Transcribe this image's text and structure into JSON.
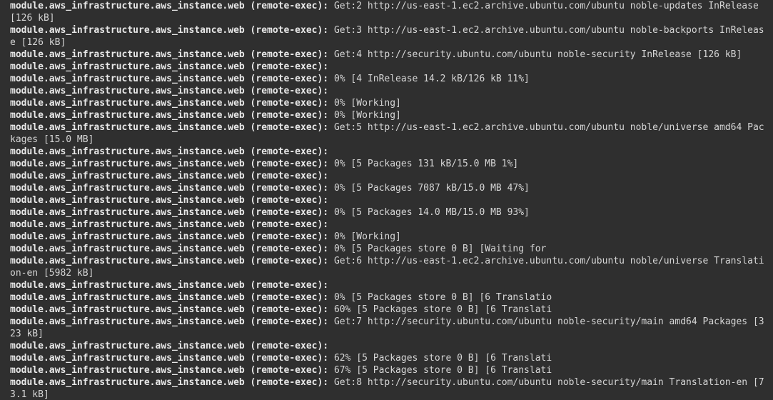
{
  "terminal": {
    "prefix": "module.aws_infrastructure.aws_instance.web (remote-exec):",
    "lines": [
      "Get:2 http://us-east-1.ec2.archive.ubuntu.com/ubuntu noble-updates InRelease [126 kB]",
      "Get:3 http://us-east-1.ec2.archive.ubuntu.com/ubuntu noble-backports InRelease [126 kB]",
      "Get:4 http://security.ubuntu.com/ubuntu noble-security InRelease [126 kB]",
      "",
      "0% [4 InRelease 14.2 kB/126 kB 11%]",
      "",
      "0% [Working]",
      "0% [Working]",
      "Get:5 http://us-east-1.ec2.archive.ubuntu.com/ubuntu noble/universe amd64 Packages [15.0 MB]",
      "",
      "0% [5 Packages 131 kB/15.0 MB 1%]",
      "",
      "0% [5 Packages 7087 kB/15.0 MB 47%]",
      "",
      "0% [5 Packages 14.0 MB/15.0 MB 93%]",
      "",
      "0% [Working]",
      "0% [5 Packages store 0 B] [Waiting for",
      "Get:6 http://us-east-1.ec2.archive.ubuntu.com/ubuntu noble/universe Translation-en [5982 kB]",
      "",
      "0% [5 Packages store 0 B] [6 Translatio",
      "60% [5 Packages store 0 B] [6 Translati",
      "Get:7 http://security.ubuntu.com/ubuntu noble-security/main amd64 Packages [323 kB]",
      "",
      "62% [5 Packages store 0 B] [6 Translati",
      "67% [5 Packages store 0 B] [6 Translati",
      "Get:8 http://security.ubuntu.com/ubuntu noble-security/main Translation-en [73.1 kB]"
    ]
  }
}
